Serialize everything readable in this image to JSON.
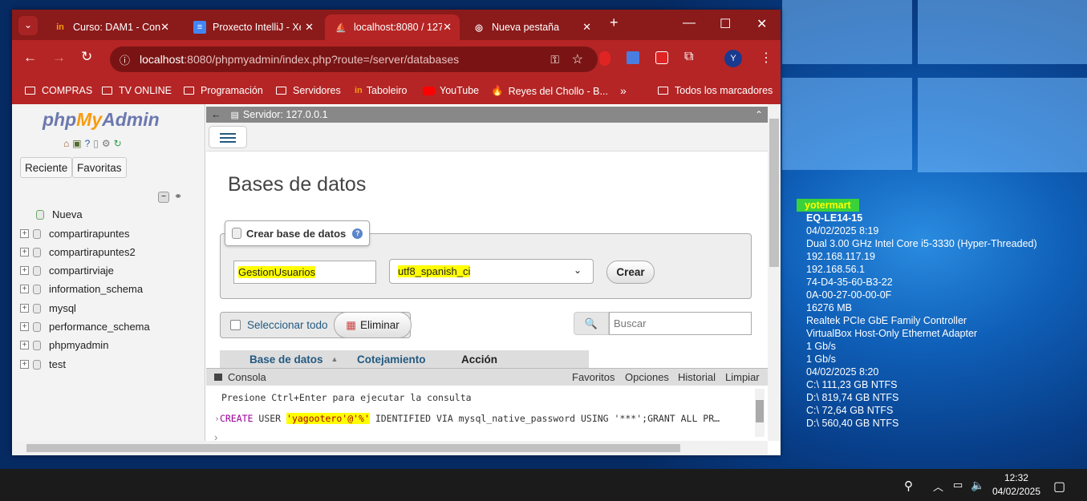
{
  "tabs": [
    {
      "title": "Curso: DAM1 - Con",
      "fav": "in"
    },
    {
      "title": "Proxecto IntelliJ - Xe",
      "fav": "≡"
    },
    {
      "title": "localhost:8080 / 127",
      "fav": "⛵"
    },
    {
      "title": "Nueva pestaña",
      "fav": "◎"
    }
  ],
  "address": {
    "host": "localhost",
    "rest": ":8080/phpmyadmin/index.php?route=/server/databases"
  },
  "profile_initial": "Y",
  "bookmarks": [
    "COMPRAS",
    "TV ONLINE",
    "Programación",
    "Servidores",
    "Taboleiro",
    "YouTube",
    "Reyes del Chollo - B...",
    "Todos los marcadores"
  ],
  "pma": {
    "logo_php": "php",
    "logo_my": "My",
    "logo_admin": "Admin",
    "recent": "Reciente",
    "favorites": "Favoritas",
    "new_db": "Nueva",
    "databases": [
      "compartirapuntes",
      "compartirapuntes2",
      "compartirviaje",
      "information_schema",
      "mysql",
      "performance_schema",
      "phpmyadmin",
      "test"
    ],
    "server": "Servidor: 127.0.0.1",
    "heading": "Bases de datos",
    "create_legend": "Crear base de datos",
    "db_name_value": "GestionUsuarios",
    "collation_value": "utf8_spanish_ci",
    "create_btn": "Crear",
    "select_all": "Seleccionar todo",
    "delete": "Eliminar",
    "search_placeholder": "Buscar",
    "columns": [
      "Base de datos",
      "Cotejamiento",
      "Acción"
    ],
    "console": {
      "label": "Consola",
      "links": [
        "Favoritos",
        "Opciones",
        "Historial",
        "Limpiar"
      ],
      "hint": "Presione Ctrl+Enter para ejecutar la consulta",
      "sql_kw": "CREATE",
      "sql_a": " USER ",
      "sql_hl": "'yagootero'@'%'",
      "sql_b": " IDENTIFIED VIA mysql_native_password USING '***';GRANT ALL PR…"
    }
  },
  "sysinfo": [
    "yotermart",
    "EQ-LE14-15",
    "04/02/2025 8:19",
    "Dual 3.00 GHz Intel Core i5-3330 (Hyper-Threaded)",
    "192.168.117.19",
    "192.168.56.1",
    "74-D4-35-60-B3-22",
    "0A-00-27-00-00-0F",
    "16276 MB",
    "Realtek PCIe GbE Family Controller",
    "VirtualBox Host-Only Ethernet Adapter",
    "1 Gb/s",
    "1 Gb/s",
    "04/02/2025 8:20",
    "C:\\ 111,23 GB NTFS",
    "D:\\ 819,74 GB NTFS",
    "C:\\ 72,64 GB NTFS",
    "D:\\ 560,40 GB NTFS"
  ],
  "clock": {
    "time": "12:32",
    "date": "04/02/2025"
  }
}
